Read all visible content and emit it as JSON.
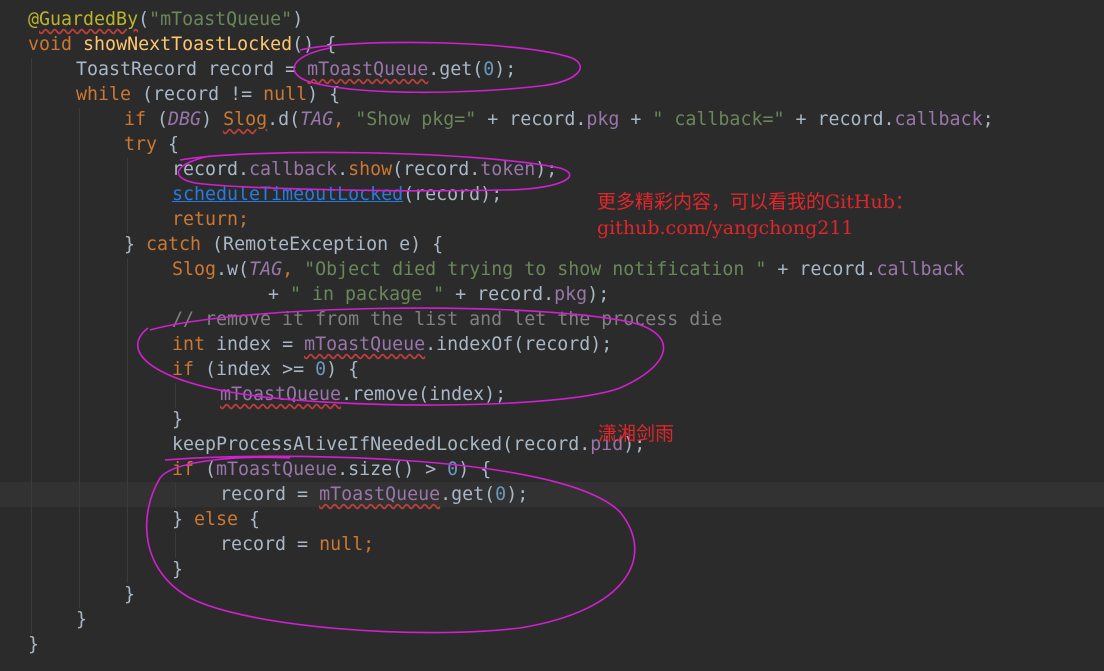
{
  "code": {
    "l1_at": "@",
    "l1_annotation": "GuardedBy",
    "l1_paren_open": "(",
    "l1_string": "\"mToastQueue\"",
    "l1_paren_close": ")",
    "l2_kw": "void",
    "l2_fn": "showNextToastLocked",
    "l2_rest": "() {",
    "l3_type": "ToastRecord record = ",
    "l3_field": "mToastQueue",
    "l3_call": ".get(",
    "l3_num": "0",
    "l3_end": ");",
    "l4_kw": "while",
    "l4_mid": " (record != ",
    "l4_null": "null",
    "l4_end": ") {",
    "l5_kw": "if",
    "l5_open": " (",
    "l5_dbg": "DBG",
    "l5_close": ") ",
    "l5_slog": "Slog",
    "l5_d": ".d(",
    "l5_tag": "TAG",
    "l5_comma": ", ",
    "l5_str1": "\"Show pkg=\"",
    "l5_plus1": " + record.",
    "l5_pkg": "pkg",
    "l5_plus2": " + ",
    "l5_str2": "\" callback=\"",
    "l5_plus3": " + record.",
    "l5_callback": "callback",
    "l5_end": ";",
    "l6_kw": "try",
    "l6_end": " {",
    "l7_a": "record.",
    "l7_callback": "callback",
    "l7_dot": ".",
    "l7_show": "show",
    "l7_b": "(record.",
    "l7_token": "token",
    "l7_end": ");",
    "l8_fn": "scheduleTimeoutLocked",
    "l8_end": "(record);",
    "l9_kw": "return",
    "l9_end": ";",
    "l10_a": "} ",
    "l10_kw": "catch",
    "l10_b": " (RemoteException e) {",
    "l11_slog": "Slog",
    "l11_w": ".w(",
    "l11_tag": "TAG",
    "l11_comma": ", ",
    "l11_str": "\"Object died trying to show notification \"",
    "l11_plus": " + record.",
    "l11_callback": "callback",
    "l12_plus": "+ ",
    "l12_str": "\" in package \"",
    "l12_mid": " + record.",
    "l12_pkg": "pkg",
    "l12_end": ");",
    "l13_comment": "// remove it from the list and let the process die",
    "l14_kw": "int",
    "l14_mid": " index = ",
    "l14_field": "mToastQueue",
    "l14_end": ".indexOf(record);",
    "l15_kw": "if",
    "l15_mid": " (index >= ",
    "l15_num": "0",
    "l15_end": ") {",
    "l16_field": "mToastQueue",
    "l16_end": ".remove(index);",
    "l17": "}",
    "l18_a": "keepProcessAliveIfNeededLocked(record.",
    "l18_pid": "pid",
    "l18_end": ");",
    "l19_kw": "if",
    "l19_a": " (",
    "l19_field": "mToastQueue",
    "l19_b": ".size() > ",
    "l19_num": "0",
    "l19_end": ") {",
    "l20_a": "record = ",
    "l20_field": "mToastQueue",
    "l20_b": ".get(",
    "l20_num": "0",
    "l20_end": ");",
    "l21_a": "} ",
    "l21_kw": "else",
    "l21_end": " {",
    "l22_a": "record = ",
    "l22_null": "null",
    "l22_end": ";",
    "l23": "}",
    "l24": "}",
    "l25": "}",
    "l26": "}"
  },
  "watermark": {
    "line1": "更多精彩内容，可以看我的GitHub：",
    "line2": "github.com/yangchong211",
    "author": "潇湘剑雨"
  },
  "colors": {
    "background": "#2b2b2b",
    "keyword": "#cc7832",
    "string": "#6a8759",
    "field": "#9876aa",
    "method": "#ffc66d",
    "annotation_ink": "#e000e0",
    "watermark_text": "#e0262b"
  }
}
